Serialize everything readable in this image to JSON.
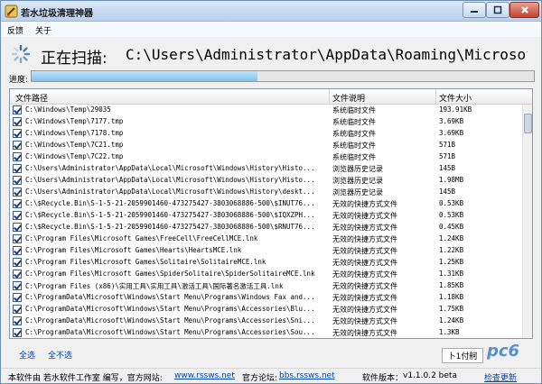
{
  "window": {
    "title": "若水垃圾清理神器",
    "menu": [
      "反馈",
      "关于"
    ]
  },
  "scan": {
    "label": "正在扫描:",
    "path": "C:\\Users\\Administrator\\AppData\\Roaming\\Microsoft"
  },
  "progress": {
    "label": "进度:",
    "fraction": 0.45
  },
  "table": {
    "headers": [
      "文件路径",
      "文件说明",
      "文件大小"
    ],
    "rows": [
      [
        "C:\\Windows\\Temp\\29035",
        "系统临时文件",
        "193.91KB"
      ],
      [
        "C:\\Windows\\Temp\\7177.tmp",
        "系统临时文件",
        "3.69KB"
      ],
      [
        "C:\\Windows\\Temp\\7178.tmp",
        "系统临时文件",
        "3.69KB"
      ],
      [
        "C:\\Windows\\Temp\\7C21.tmp",
        "系统临时文件",
        "571B"
      ],
      [
        "C:\\Windows\\Temp\\7C22.tmp",
        "系统临时文件",
        "571B"
      ],
      [
        "C:\\Users\\Administrator\\AppData\\Local\\Microsoft\\Windows\\History\\Histo...",
        "浏览器历史记录",
        "145B"
      ],
      [
        "C:\\Users\\Administrator\\AppData\\Local\\Microsoft\\Windows\\History\\Histo...",
        "浏览器历史记录",
        "1.98MB"
      ],
      [
        "C:\\Users\\Administrator\\AppData\\Local\\Microsoft\\Windows\\History\\deskt...",
        "浏览器历史记录",
        "145B"
      ],
      [
        "C:\\$Recycle.Bin\\S-1-5-21-2059901460-473275427-3803068886-500\\$INUT76...",
        "无效的快捷方式文件",
        "0.53KB"
      ],
      [
        "C:\\$Recycle.Bin\\S-1-5-21-2059901460-473275427-3803068886-500\\$IQXZPH...",
        "无效的快捷方式文件",
        "0.53KB"
      ],
      [
        "C:\\$Recycle.Bin\\S-1-5-21-2059901460-473275427-3803068886-500\\$RNUT76...",
        "无效的快捷方式文件",
        "0.45KB"
      ],
      [
        "C:\\Program Files\\Microsoft Games\\FreeCell\\FreeCellMCE.lnk",
        "无效的快捷方式文件",
        "1.24KB"
      ],
      [
        "C:\\Program Files\\Microsoft Games\\Hearts\\HeartsMCE.lnk",
        "无效的快捷方式文件",
        "1.22KB"
      ],
      [
        "C:\\Program Files\\Microsoft Games\\Solitaire\\SolitaireMCE.lnk",
        "无效的快捷方式文件",
        "1.25KB"
      ],
      [
        "C:\\Program Files\\Microsoft Games\\SpiderSolitaire\\SpiderSolitaireMCE.lnk",
        "无效的快捷方式文件",
        "1.31KB"
      ],
      [
        "C:\\Program Files (x86)\\实用工具\\实用工具\\激活工具\\国际著名激活工具.lnk",
        "无效的快捷方式文件",
        "1.85KB"
      ],
      [
        "C:\\ProgramData\\Microsoft\\Windows\\Start Menu\\Programs\\Windows Fax and...",
        "无效的快捷方式文件",
        "1.18KB"
      ],
      [
        "C:\\ProgramData\\Microsoft\\Windows\\Start Menu\\Programs\\Accessories\\Blu...",
        "无效的快捷方式文件",
        "1.75KB"
      ],
      [
        "C:\\ProgramData\\Microsoft\\Windows\\Start Menu\\Programs\\Accessories\\Sni...",
        "无效的快捷方式文件",
        "1.24KB"
      ],
      [
        "C:\\ProgramData\\Microsoft\\Windows\\Start Menu\\Programs\\Accessories\\Sou...",
        "无效的快捷方式文件",
        "1.3KB"
      ],
      [
        "C:\\ProgramData\\Microsoft\\Windows\\Start Menu\\Programs\\Accessories\\Sti...",
        "无效的快捷方式文件",
        "1.32KB"
      ]
    ]
  },
  "actions": {
    "select_all": "全选",
    "select_none": "全不选",
    "scroll_button": "卜1付舸"
  },
  "watermark": "pc6",
  "status": {
    "software_by": "本软件由 若水软件工作室 编写，官方网站:",
    "website": "www.rssws.net",
    "forum_label": "官方论坛:",
    "forum": "bbs.rssws.net",
    "version_label": "软件版本：",
    "version": "v1.1.0.2 beta",
    "update": "检查更新"
  },
  "colors": {
    "accent": "#0047b3",
    "progress": "#7fc2ee",
    "title_bar": "#c8dbf2"
  }
}
